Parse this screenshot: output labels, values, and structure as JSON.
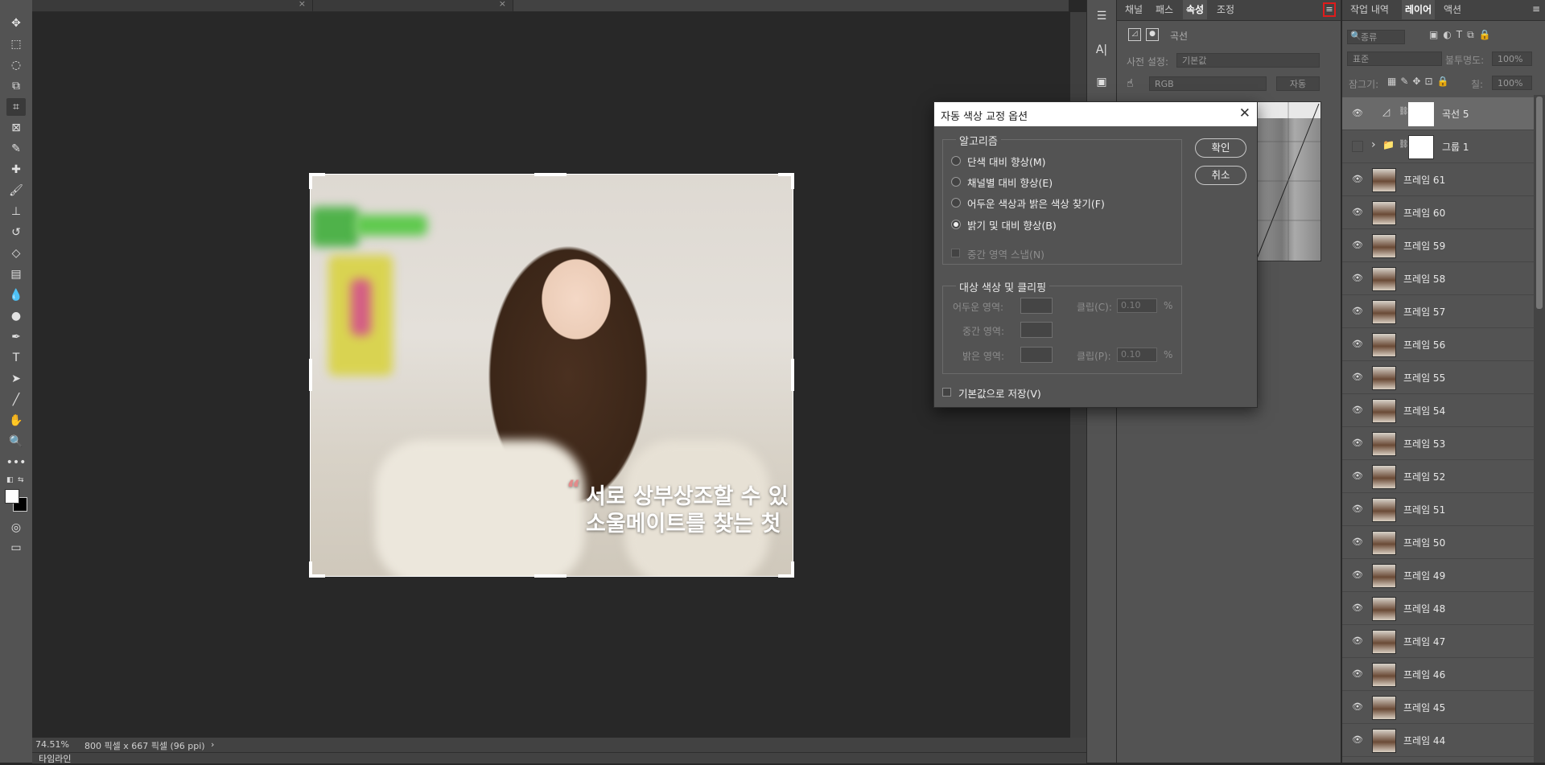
{
  "document": {
    "zoom": "74.51%",
    "info": "800 픽셀 x 667 픽셀 (96 ppi)",
    "timeline_label": "타임라인"
  },
  "image_text": {
    "quote_mark": "“",
    "line1": "서로 상부상조할 수 있",
    "line2": "소울메이트를 찾는 첫"
  },
  "properties": {
    "tabs": [
      "채널",
      "패스",
      "속성",
      "조정"
    ],
    "active_tab": "속성",
    "header_label": "곡선",
    "preset_label": "사전 설정:",
    "preset_value": "기본값",
    "channel_value": "RGB",
    "auto_label": "자동"
  },
  "layers_panel": {
    "tabs": [
      "작업 내역",
      "레이어",
      "액션"
    ],
    "filter_placeholder": "종류",
    "blend_mode": "표준",
    "opacity_label": "불투명도:",
    "opacity_value": "100%",
    "lock_label": "잠그기:",
    "fill_label": "칠:",
    "fill_value": "100%",
    "layers": [
      {
        "name": "곡선 5",
        "visible": true,
        "type": "adjustment"
      },
      {
        "name": "그룹 1",
        "visible": false,
        "type": "group"
      },
      {
        "name": "프레임 61",
        "visible": true
      },
      {
        "name": "프레임 60",
        "visible": true
      },
      {
        "name": "프레임 59",
        "visible": true
      },
      {
        "name": "프레임 58",
        "visible": true
      },
      {
        "name": "프레임 57",
        "visible": true
      },
      {
        "name": "프레임 56",
        "visible": true
      },
      {
        "name": "프레임 55",
        "visible": true
      },
      {
        "name": "프레임 54",
        "visible": true
      },
      {
        "name": "프레임 53",
        "visible": true
      },
      {
        "name": "프레임 52",
        "visible": true
      },
      {
        "name": "프레임 51",
        "visible": true
      },
      {
        "name": "프레임 50",
        "visible": true
      },
      {
        "name": "프레임 49",
        "visible": true
      },
      {
        "name": "프레임 48",
        "visible": true
      },
      {
        "name": "프레임 47",
        "visible": true
      },
      {
        "name": "프레임 46",
        "visible": true
      },
      {
        "name": "프레임 45",
        "visible": true
      },
      {
        "name": "프레임 44",
        "visible": true
      }
    ]
  },
  "dialog": {
    "title": "자동 색상 교정 옵션",
    "algorithm_group": "알고리즘",
    "options": [
      {
        "label": "단색 대비 향상(M)",
        "checked": false
      },
      {
        "label": "채널별 대비 향상(E)",
        "checked": false
      },
      {
        "label": "어두운 색상과 밝은 색상 찾기(F)",
        "checked": false
      },
      {
        "label": "밝기 및 대비 향상(B)",
        "checked": true
      }
    ],
    "snap_label": "중간 영역 스냅(N)",
    "target_group": "대상 색상 및 클리핑",
    "shadows_label": "어두운 영역:",
    "midtones_label": "중간 영역:",
    "highlights_label": "밝은 영역:",
    "clip_c_label": "클립(C):",
    "clip_p_label": "클립(P):",
    "clip_c_value": "0.10",
    "clip_p_value": "0.10",
    "percent": "%",
    "save_default_label": "기본값으로 저장(V)",
    "ok_label": "확인",
    "cancel_label": "취소"
  },
  "colors": {
    "panel_bg": "#535353",
    "canvas_bg": "#282828",
    "highlight_box": "#e01b1b"
  }
}
